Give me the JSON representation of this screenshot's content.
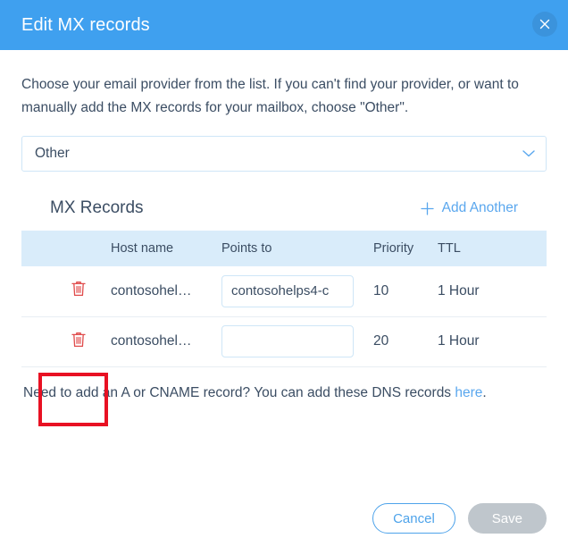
{
  "header": {
    "title": "Edit MX records",
    "close_label": "×",
    "background_color": "#3fa0ef"
  },
  "body": {
    "intro_text": "Choose your email provider from the list. If you can't find your provider, or want to manually add the MX records for your mailbox, choose \"Other\".",
    "provider_select": {
      "value": "Other",
      "options": [
        "Other"
      ]
    }
  },
  "records": {
    "section_title": "MX Records",
    "add_another_label": "Add Another",
    "columns": [
      "",
      "Host name",
      "Points to",
      "Priority",
      "TTL"
    ],
    "rows": [
      {
        "delete_label": "Delete record",
        "host_name": "contosohel…",
        "points_to_value": "contosohelps4-c",
        "points_to_placeholder": "",
        "priority": "10",
        "ttl": "1 Hour"
      },
      {
        "delete_label": "Delete record",
        "host_name": "contosohel…",
        "points_to_value": "",
        "points_to_placeholder": "",
        "priority": "20",
        "ttl": "1 Hour"
      }
    ]
  },
  "dns_note": {
    "text_before": "Need to add an A or CNAME record? You can add these DNS records ",
    "link_text": "here",
    "text_after": "."
  },
  "footer": {
    "cancel_label": "Cancel",
    "save_label": "Save"
  },
  "annotation": {
    "color": "#e81123",
    "target": "delete-icon-row-2"
  },
  "colors": {
    "accent_blue": "#5aa7ee",
    "header_blue": "#3fa0ef",
    "table_header_blue": "#d9ecfa",
    "trash_red": "#e04b4b",
    "text": "#3b4d63"
  }
}
